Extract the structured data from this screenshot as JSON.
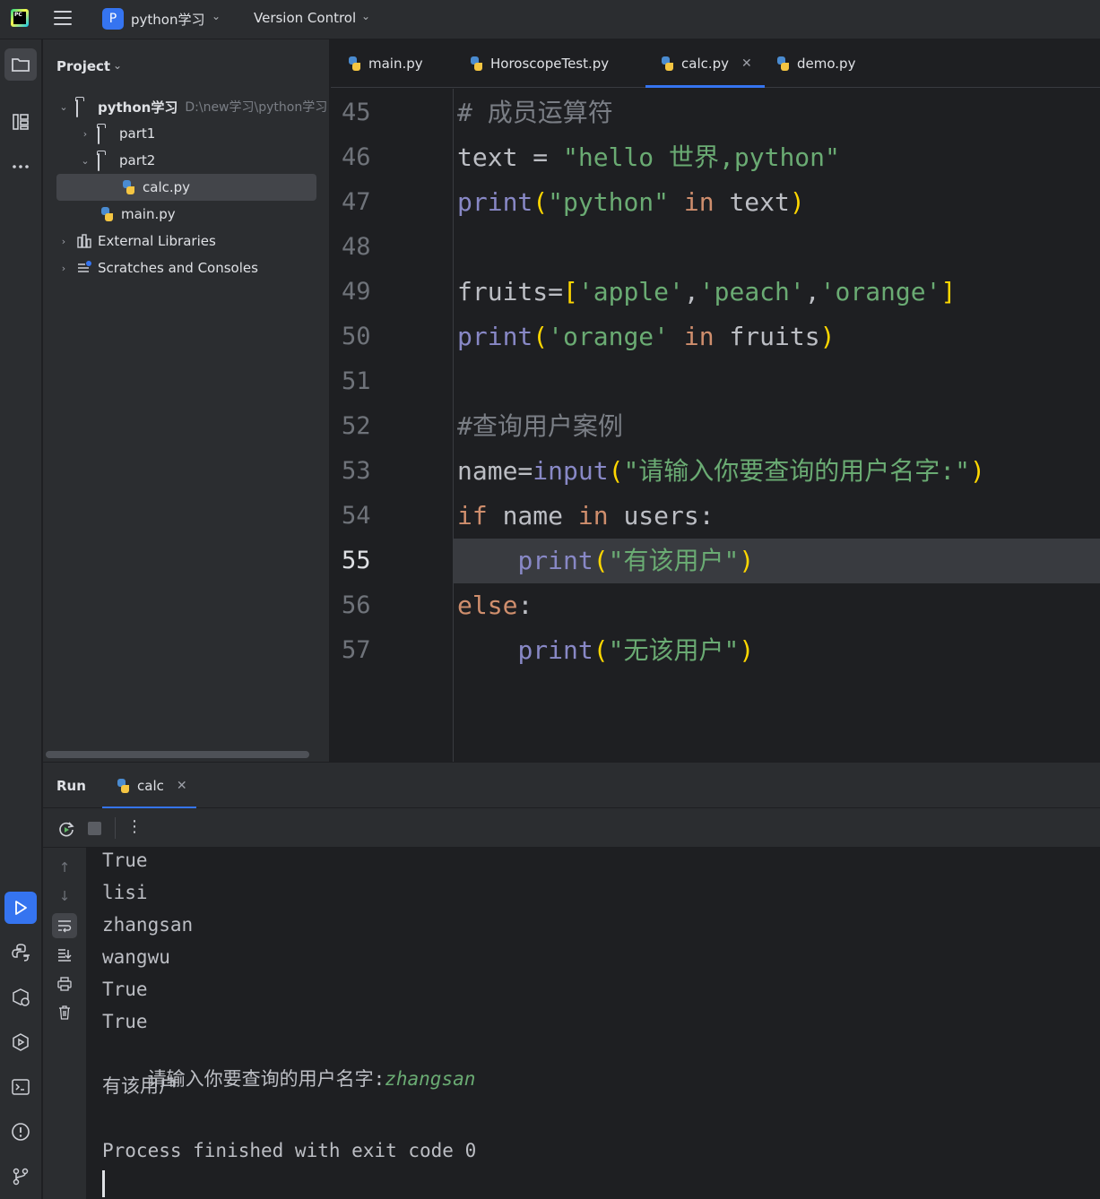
{
  "titlebar": {
    "project_badge": "P",
    "project_name": "python学习",
    "vcs_label": "Version Control"
  },
  "project_panel": {
    "title": "Project",
    "tree": [
      {
        "label": "python学习",
        "path": "D:\\new学习\\python学习"
      },
      {
        "label": "part1"
      },
      {
        "label": "part2"
      },
      {
        "label": "calc.py",
        "selected": true
      },
      {
        "label": "main.py"
      },
      {
        "label": "External Libraries"
      },
      {
        "label": "Scratches and Consoles"
      }
    ]
  },
  "editor": {
    "tabs": [
      {
        "label": "main.py"
      },
      {
        "label": "HoroscopeTest.py"
      },
      {
        "label": "calc.py",
        "active": true
      },
      {
        "label": "demo.py"
      }
    ],
    "current_line": "55",
    "lines": [
      {
        "n": "45",
        "t": [
          "# 成员运算符"
        ]
      },
      {
        "n": "46",
        "t": [
          "text",
          " = ",
          "\"hello 世界,python\""
        ]
      },
      {
        "n": "47",
        "t": [
          "print",
          "(",
          "\"python\"",
          " in ",
          "text",
          ")"
        ]
      },
      {
        "n": "48",
        "t": []
      },
      {
        "n": "49",
        "t": [
          "fruits=",
          "[",
          "'apple'",
          ",",
          "'peach'",
          ",",
          "'orange'",
          "]"
        ]
      },
      {
        "n": "50",
        "t": [
          "print",
          "(",
          "'orange'",
          " in ",
          "fruits",
          ")"
        ]
      },
      {
        "n": "51",
        "t": []
      },
      {
        "n": "52",
        "t": [
          "#查询用户案例"
        ]
      },
      {
        "n": "53",
        "t": [
          "name=",
          "input",
          "(",
          "\"请输入你要查询的用户名字:\"",
          ")"
        ]
      },
      {
        "n": "54",
        "t": [
          "if",
          " name ",
          "in",
          " users:"
        ]
      },
      {
        "n": "55",
        "t": [
          "    ",
          "print",
          "(",
          "\"有该用户\"",
          ")"
        ]
      },
      {
        "n": "56",
        "t": [
          "else",
          ":"
        ]
      },
      {
        "n": "57",
        "t": [
          "    ",
          "print",
          "(",
          "\"无该用户\"",
          ")"
        ]
      }
    ]
  },
  "run_panel": {
    "title": "Run",
    "tab_label": "calc",
    "output": [
      "True",
      "lisi",
      "zhangsan",
      "wangwu",
      "True",
      "True"
    ],
    "prompt": "请输入你要查询的用户名字:",
    "user_input": "zhangsan",
    "result": "有该用户",
    "exit_message": "Process finished with exit code 0"
  },
  "colors": {
    "accent": "#3574f0",
    "keyword": "#cf8e6d",
    "builtin": "#8888c6",
    "string": "#6aab73",
    "comment": "#7a7e85"
  }
}
